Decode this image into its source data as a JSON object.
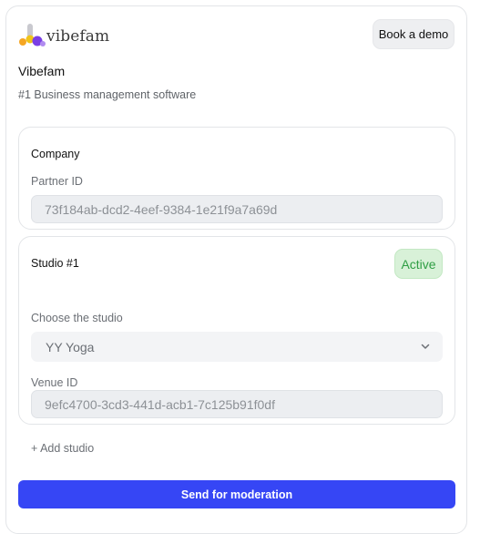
{
  "header": {
    "logo_text": "vibefam",
    "demo_button": "Book a demo"
  },
  "app": {
    "title": "Vibefam",
    "subtitle": "#1 Business management software"
  },
  "company": {
    "title": "Company",
    "partner_id_label": "Partner ID",
    "partner_id_value": "73f184ab-dcd2-4eef-9384-1e21f9a7a69d"
  },
  "studio": {
    "title": "Studio #1",
    "status": "Active",
    "status_color": "#2f9e44",
    "choose_label": "Choose the studio",
    "selected_studio": "YY Yoga",
    "venue_id_label": "Venue ID",
    "venue_id_value": "9efc4700-3cd3-441d-acb1-7c125b91f0df"
  },
  "actions": {
    "add_studio": "+ Add studio",
    "send": "Send for moderation",
    "send_color": "#3646f5"
  }
}
